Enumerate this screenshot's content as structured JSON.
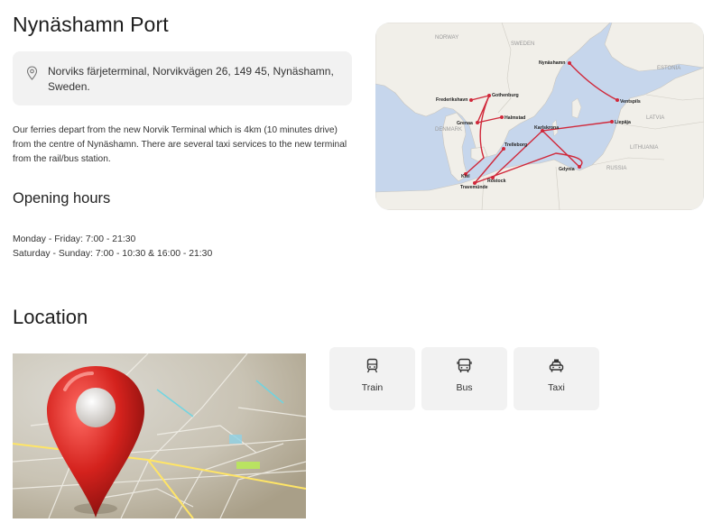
{
  "port": {
    "title": "Nynäshamn Port",
    "address": "Norviks färjeterminal, Norvikvägen 26, 149 45, Nynäshamn, Sweden.",
    "intro": "Our ferries depart from the new Norvik Terminal which is 4km (10 minutes drive) from the centre of Nynäshamn. There are several taxi services to the new terminal from the rail/bus station."
  },
  "opening_hours": {
    "heading": "Opening hours",
    "weekday": "Monday - Friday: 7:00 - 21:30",
    "weekend": "Saturday - Sunday: 7:00 - 10:30 & 16:00 - 21:30"
  },
  "route_map": {
    "country_labels": [
      "NORWAY",
      "SWEDEN",
      "ESTONIA",
      "LATVIA",
      "DENMARK",
      "LITHUANIA",
      "RUSSIA"
    ],
    "ports": [
      "Nynäshamn",
      "Ventspils",
      "Liepāja",
      "Karlskrona",
      "Gdynia",
      "Frederikshavn",
      "Gothenburg",
      "Halmstad",
      "Grenaa",
      "Trelleborg",
      "Kiel",
      "Rostock",
      "Travemünde"
    ],
    "route_color": "#d0283a",
    "land_color": "#f1efe9",
    "water_color": "#c6d6ec"
  },
  "location": {
    "heading": "Location",
    "photo_icon": "map-pin-photo"
  },
  "transport": [
    {
      "label": "Train",
      "icon": "train-icon"
    },
    {
      "label": "Bus",
      "icon": "bus-icon"
    },
    {
      "label": "Taxi",
      "icon": "taxi-icon"
    }
  ]
}
